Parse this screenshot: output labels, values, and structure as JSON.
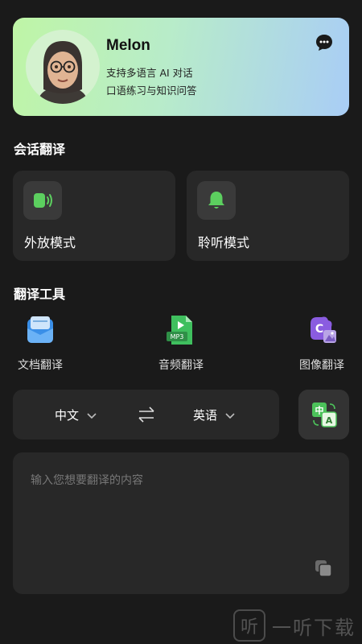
{
  "profile": {
    "name": "Melon",
    "line1": "支持多语言 AI 对话",
    "line2": "口语练习与知识问答",
    "chat_icon": "chat-bubble-icon",
    "avatar": "memoji-avatar"
  },
  "conversation": {
    "title": "会话翻译",
    "cards": [
      {
        "label": "外放模式",
        "icon": "speaker-icon"
      },
      {
        "label": "聆听模式",
        "icon": "bell-icon"
      }
    ]
  },
  "tools": {
    "title": "翻译工具",
    "items": [
      {
        "label": "文档翻译",
        "icon": "document-icon"
      },
      {
        "label": "音频翻译",
        "icon": "audio-file-icon",
        "badge": "MP3"
      },
      {
        "label": "图像翻译",
        "icon": "image-icon"
      }
    ]
  },
  "language_bar": {
    "source": "中文",
    "target": "英语",
    "swap_icon": "swap-arrows-icon"
  },
  "translate_button": {
    "top": "中",
    "bottom": "A"
  },
  "input": {
    "placeholder": "输入您想要翻译的内容",
    "copy_icon": "copy-icon"
  },
  "watermark": {
    "logo": "听",
    "text": "一听下载"
  },
  "colors": {
    "background": "#1a1a1a",
    "card": "#282828",
    "accent_green": "#5ccf5f",
    "hero_gradient_start": "#bff5a6",
    "hero_gradient_end": "#a9cdf6"
  }
}
